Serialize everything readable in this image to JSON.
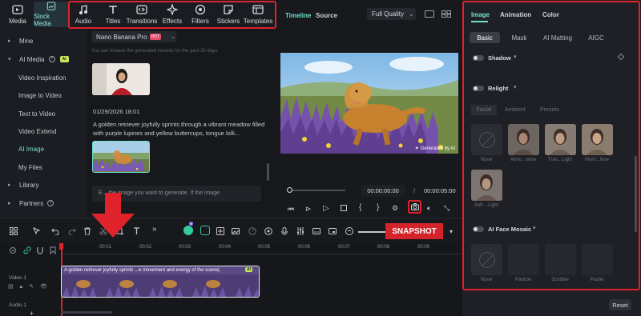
{
  "toolbar": {
    "items": [
      {
        "label": "Media",
        "icon": "media-icon"
      },
      {
        "label": "Stock Media",
        "icon": "stock-media-icon"
      },
      {
        "label": "Audio",
        "icon": "music-note-icon"
      },
      {
        "label": "Titles",
        "icon": "text-t-icon"
      },
      {
        "label": "Transitions",
        "icon": "transitions-icon"
      },
      {
        "label": "Effects",
        "icon": "sparkle-icon"
      },
      {
        "label": "Filters",
        "icon": "filters-icon"
      },
      {
        "label": "Stickers",
        "icon": "sticker-icon"
      },
      {
        "label": "Templates",
        "icon": "templates-icon"
      }
    ]
  },
  "sidebar": {
    "items": [
      {
        "label": "Mine"
      },
      {
        "label": "AI Media",
        "badge": "AI"
      },
      {
        "label": "Video Inspiration"
      },
      {
        "label": "Image to Video"
      },
      {
        "label": "Text to Video"
      },
      {
        "label": "Video Extend"
      },
      {
        "label": "AI Image"
      },
      {
        "label": "My Files"
      },
      {
        "label": "Library"
      },
      {
        "label": "Partners"
      }
    ]
  },
  "generator": {
    "model": "Nano Banana Pro",
    "model_badge": "HOT",
    "notice": "You can browse the generated records for the past 30 days.",
    "record_date": "01/29/2026 18:01",
    "prompt_text": "A golden retriever joyfully sprints through a vibrant meadow filled with purple lupines and yellow buttercups, tongue lolli...",
    "input_placeholder": "E... the image you want to generate. If the image"
  },
  "preview": {
    "tab_timeline": "Timeline",
    "tab_source": "Source",
    "quality": "Full Quality",
    "watermark": "Generated by AI",
    "time_current": "00:00:00:00",
    "time_sep": "/",
    "time_total": "00:00:05:00"
  },
  "inspector": {
    "tabs": [
      "Image",
      "Animation",
      "Color"
    ],
    "subtabs": [
      "Basic",
      "Mask",
      "AI Matting",
      "AIGC"
    ],
    "shadow_label": "Shadow",
    "relight_label": "Relight",
    "relight_tabs": [
      "Facial",
      "Ambient",
      "Presets"
    ],
    "relight_presets": [
      "None",
      "Atmo...sone",
      "Tran...Light",
      "Morn...hine",
      "Soft ...Light"
    ],
    "mosaic_label": "AI Face Mosaic",
    "mosaic_presets": [
      "None",
      "Particle",
      "Scribble",
      "Pastel"
    ],
    "reset_label": "Reset"
  },
  "timeline": {
    "snapshot_label": "SNAPSHOT",
    "timecodes": [
      "00:00",
      "00:01",
      "00:02",
      "00:03",
      "00:04",
      "00:05",
      "00:06",
      "00:07",
      "00:08",
      "00:09"
    ],
    "clip_title": "A golden retriever joyfully sprints ...e movement and energy of the scene|.",
    "clip_badge": "AI",
    "track_video": "Video 1",
    "track_audio": "Audio 1"
  },
  "colors": {
    "accent": "#6fe0cf",
    "highlight": "#e0232b",
    "background": "#121418"
  }
}
